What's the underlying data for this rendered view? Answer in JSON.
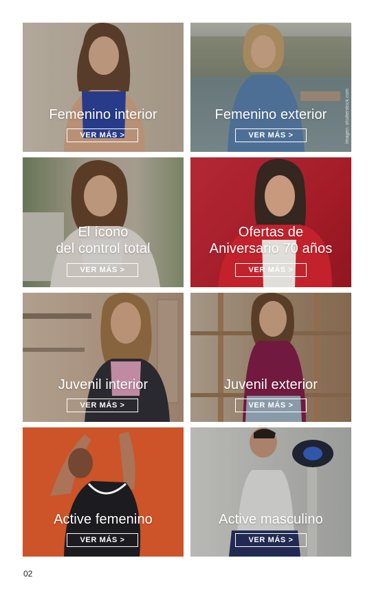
{
  "tiles": [
    {
      "title_lines": [
        "Femenino interior"
      ],
      "button": "VER MÁS >"
    },
    {
      "title_lines": [
        "Femenino exterior"
      ],
      "button": "VER MÁS >",
      "photo_credit": "Imagen: shutterstock.com"
    },
    {
      "title_lines": [
        "El ícono",
        "del control total"
      ],
      "button": "VER MÁS >"
    },
    {
      "title_lines": [
        "Ofertas de",
        "Aniversario 70 años"
      ],
      "button": "VER MÁS >"
    },
    {
      "title_lines": [
        "Juvenil interior"
      ],
      "button": "VER MÁS >"
    },
    {
      "title_lines": [
        "Juvenil exterior"
      ],
      "button": "VER MÁS >"
    },
    {
      "title_lines": [
        "Active femenino"
      ],
      "button": "VER MÁS >"
    },
    {
      "title_lines": [
        "Active masculino"
      ],
      "button": "VER MÁS >"
    }
  ],
  "page_number": "02",
  "colors": {
    "tile_beige": "#d8cbb8",
    "tile_sea": "#8fa3a8",
    "tile_garden": "#b9b19c",
    "tile_red": "#b5242f",
    "tile_kitchen": "#c9a98e",
    "tile_shelf": "#a8896c",
    "tile_orange": "#d8572a",
    "tile_gym": "#cfd0cc"
  }
}
